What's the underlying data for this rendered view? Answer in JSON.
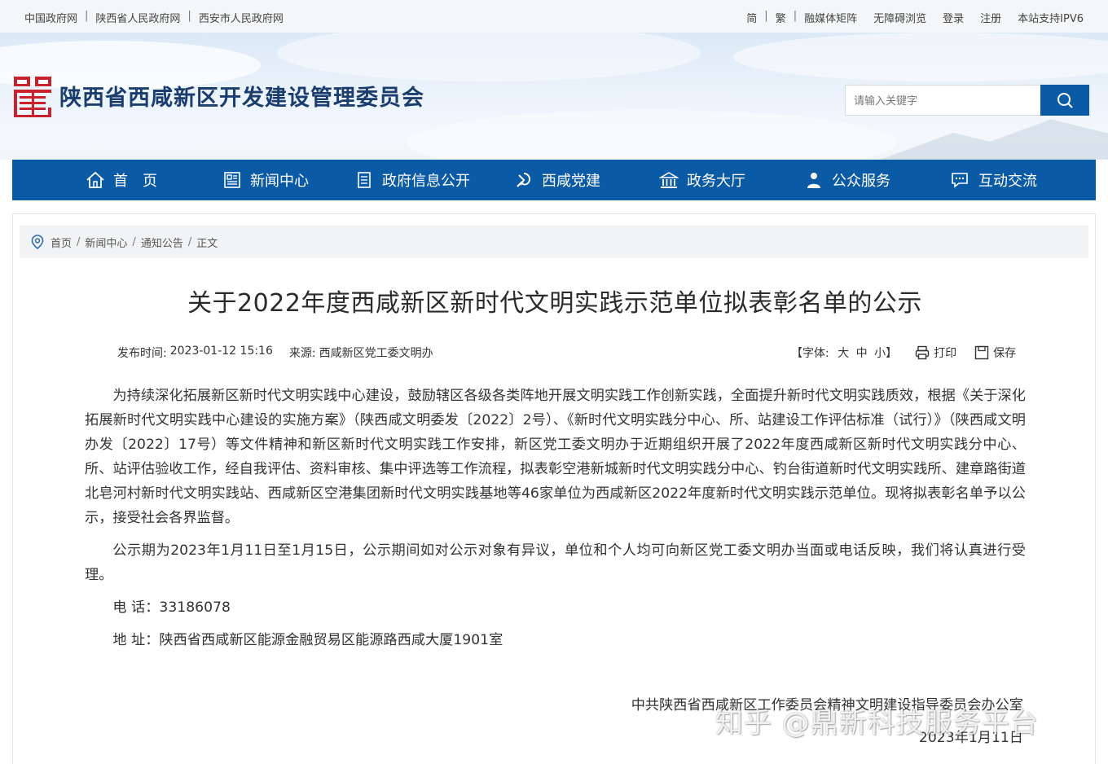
{
  "topbar": {
    "left_links": [
      "中国政府网",
      "陕西省人民政府网",
      "西安市人民政府网"
    ],
    "right_links": [
      "简",
      "繁",
      "融媒体矩阵",
      "无障碍浏览",
      "登录",
      "注册",
      "本站支持IPV6"
    ]
  },
  "header": {
    "site_title": "陕西省西咸新区开发建设管理委员会",
    "search_placeholder": "请输入关键字"
  },
  "nav": {
    "items": [
      {
        "label": "首　页",
        "icon": "home-icon"
      },
      {
        "label": "新闻中心",
        "icon": "newspaper-icon"
      },
      {
        "label": "政府信息公开",
        "icon": "document-list-icon"
      },
      {
        "label": "西咸党建",
        "icon": "party-emblem-icon"
      },
      {
        "label": "政务大厅",
        "icon": "government-building-icon"
      },
      {
        "label": "公众服务",
        "icon": "person-icon"
      },
      {
        "label": "互动交流",
        "icon": "chat-icon"
      }
    ]
  },
  "breadcrumb": {
    "items": [
      "首页",
      "新闻中心",
      "通知公告",
      "正文"
    ]
  },
  "article": {
    "title": "关于2022年度西咸新区新时代文明实践示范单位拟表彰名单的公示",
    "publish_label": "发布时间:",
    "publish_time": "2023-01-12 15:16",
    "source_label": "来源:",
    "source": "西咸新区党工委文明办",
    "font_prefix": "【字体:",
    "font_large": "大",
    "font_medium": "中",
    "font_small": "小】",
    "print_label": "打印",
    "save_label": "保存",
    "paragraph1": "为持续深化拓展新区新时代文明实践中心建设，鼓励辖区各级各类阵地开展文明实践工作创新实践，全面提升新时代文明实践质效，根据《关于深化拓展新时代文明实践中心建设的实施方案》（陕西咸文明委发〔2022〕2号）、《新时代文明实践分中心、所、站建设工作评估标准（试行）》（陕西咸文明办发〔2022〕17号）等文件精神和新区新时代文明实践工作安排，新区党工委文明办于近期组织开展了2022年度西咸新区新时代文明实践分中心、所、站评估验收工作，经自我评估、资料审核、集中评选等工作流程，拟表彰空港新城新时代文明实践分中心、钓台街道新时代文明实践所、建章路街道北皂河村新时代文明实践站、西咸新区空港集团新时代文明实践基地等46家单位为西咸新区2022年度新时代文明实践示范单位。现将拟表彰名单予以公示，接受社会各界监督。",
    "paragraph2": "公示期为2023年1月11日至1月15日，公示期间如对公示对象有异议，单位和个人均可向新区党工委文明办当面或电话反映，我们将认真进行受理。",
    "phone_line": "电 话：33186078",
    "address_line": "地 址：陕西省西咸新区能源金融贸易区能源路西咸大厦1901室",
    "signature": "中共陕西省西咸新区工作委员会精神文明建设指导委员会办公室",
    "date": "2023年1月11日"
  },
  "watermark": "知乎 @鼎新科技服务平台",
  "colors": {
    "nav_bg": "#0b5aa6",
    "title_text": "#1b3d6e",
    "logo_red": "#c8232c"
  }
}
